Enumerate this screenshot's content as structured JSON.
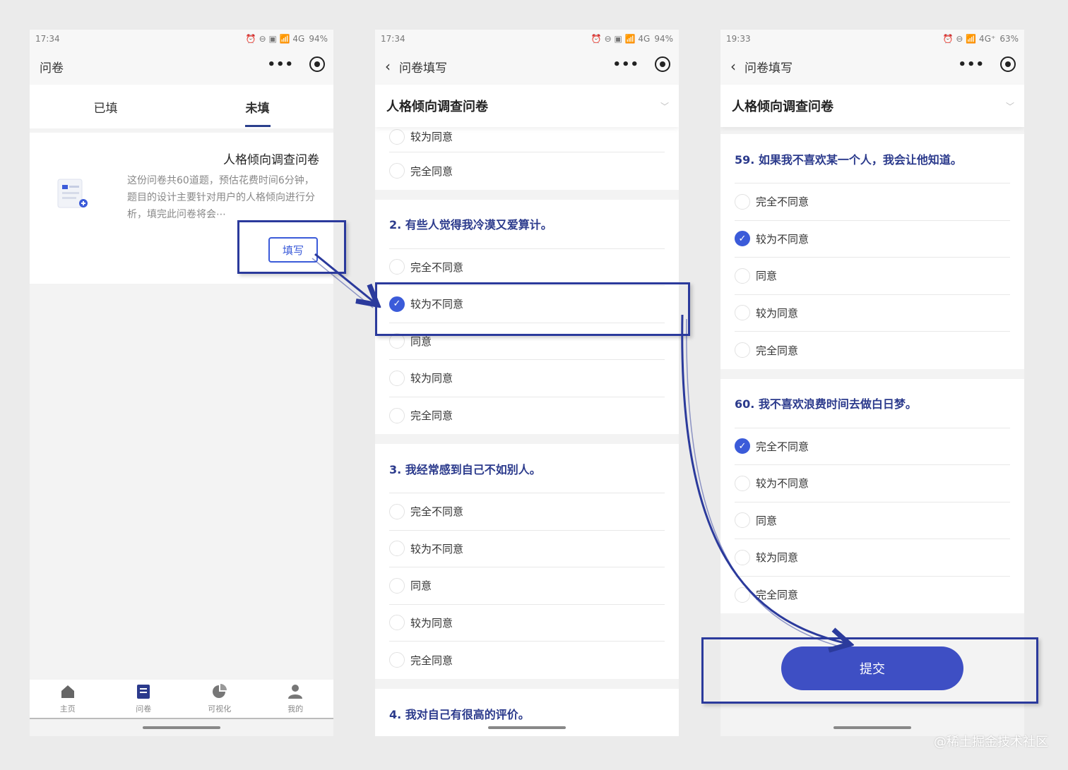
{
  "phone1": {
    "status": {
      "time": "17:34",
      "icons": "⏰ ⊖ ▣ 📶 4G",
      "battery": "94%"
    },
    "nav_title": "问卷",
    "tabs": [
      "已填",
      "未填"
    ],
    "card": {
      "title": "人格倾向调查问卷",
      "desc": "这份问卷共60道题，预估花费时间6分钟，题目的设计主要针对用户的人格倾向进行分析，填完此问卷将会⋯",
      "button": "填写"
    },
    "tabbar": [
      "主页",
      "问卷",
      "可视化",
      "我的"
    ]
  },
  "phone2": {
    "status": {
      "time": "17:34",
      "icons": "⏰ ⊖ ▣ 📶 4G",
      "battery": "94%"
    },
    "nav_title": "问卷填写",
    "sheet_title": "人格倾向调查问卷",
    "partial_options": [
      "较为同意",
      "完全同意"
    ],
    "questions": [
      {
        "title": "2. 有些人觉得我冷漠又爱算计。",
        "options": [
          "完全不同意",
          "较为不同意",
          "同意",
          "较为同意",
          "完全同意"
        ],
        "selected": 1
      },
      {
        "title": "3. 我经常感到自己不如别人。",
        "options": [
          "完全不同意",
          "较为不同意",
          "同意",
          "较为同意",
          "完全同意"
        ],
        "selected": -1
      }
    ],
    "next_question": "4. 我对自己有很高的评价。"
  },
  "phone3": {
    "status": {
      "time": "19:33",
      "icons": "⏰ ⊖ 📶 4G⁺",
      "battery": "63%"
    },
    "nav_title": "问卷填写",
    "sheet_title": "人格倾向调查问卷",
    "questions": [
      {
        "title": "59. 如果我不喜欢某一个人，我会让他知道。",
        "options": [
          "完全不同意",
          "较为不同意",
          "同意",
          "较为同意",
          "完全同意"
        ],
        "selected": 1
      },
      {
        "title": "60. 我不喜欢浪费时间去做白日梦。",
        "options": [
          "完全不同意",
          "较为不同意",
          "同意",
          "较为同意",
          "完全同意"
        ],
        "selected": 0
      }
    ],
    "submit": "提交"
  },
  "watermark": "@稀土掘金技术社区",
  "colors": {
    "accent": "#3b5bd9",
    "highlight": "#2b3a9c",
    "submit": "#3e4fc4"
  }
}
